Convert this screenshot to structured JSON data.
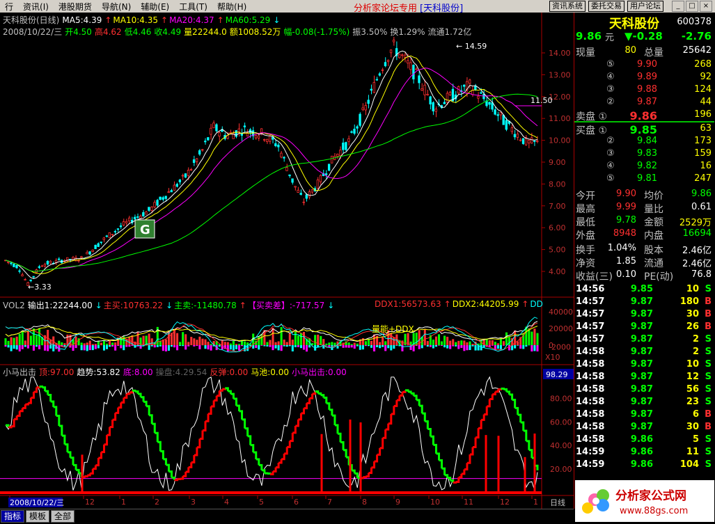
{
  "menu": [
    "行",
    "资讯(I)",
    "港股期货",
    "导航(N)",
    "辅助(E)",
    "工具(T)",
    "帮助(H)"
  ],
  "banner": {
    "text": "分析家论坛专用",
    "stock": "[天科股份]"
  },
  "top_buttons": [
    "资讯系统",
    "委托交易",
    "用户论坛"
  ],
  "window_controls": [
    "_",
    "□",
    "×"
  ],
  "price_panel": {
    "line1": [
      {
        "text": "天科股份(日线)",
        "color": "#c0c0c0"
      },
      {
        "text": "MA5:4.39",
        "color": "#ffffff"
      },
      {
        "text": "↑",
        "color": "#ff3030"
      },
      {
        "text": "MA10:4.35",
        "color": "#ffff00"
      },
      {
        "text": "↑",
        "color": "#ff3030"
      },
      {
        "text": "MA20:4.37",
        "color": "#ff00ff"
      },
      {
        "text": "↑",
        "color": "#ff3030"
      },
      {
        "text": "MA60:5.29",
        "color": "#00ff00"
      },
      {
        "text": "↓",
        "color": "#00ffff"
      }
    ],
    "line2": [
      {
        "text": "2008/10/22/三",
        "color": "#c0c0c0"
      },
      {
        "text": "开4.50",
        "color": "#00ff00"
      },
      {
        "text": "高4.62",
        "color": "#ff3030"
      },
      {
        "text": "低4.46",
        "color": "#00ff00"
      },
      {
        "text": "收4.49",
        "color": "#00ff00"
      },
      {
        "text": "量22244.0",
        "color": "#ffff00"
      },
      {
        "text": "额1008.52万",
        "color": "#ffff00"
      },
      {
        "text": "幅-0.08(-1.75%)",
        "color": "#00ff00"
      },
      {
        "text": "振3.50%",
        "color": "#c0c0c0"
      },
      {
        "text": "换1.29%",
        "color": "#c0c0c0"
      },
      {
        "text": "流通1.72亿",
        "color": "#c0c0c0"
      }
    ],
    "y_ticks": [
      "14.00",
      "13.00",
      "12.00",
      "11.00",
      "10.00",
      "9.00",
      "8.00",
      "7.00",
      "6.00",
      "5.00",
      "4.00"
    ],
    "high_label": "14.59",
    "low_label": "3.33",
    "current_marker": "11.50",
    "badge": "G"
  },
  "vol_panel": {
    "items": [
      {
        "text": "VOL2",
        "color": "#c0c0c0"
      },
      {
        "text": "输出1:22244.00",
        "color": "#ffffff"
      },
      {
        "text": "↓",
        "color": "#00ffff"
      },
      {
        "text": "主买:10763.22",
        "color": "#ff3030"
      },
      {
        "text": "↓",
        "color": "#00ffff"
      },
      {
        "text": "主卖:-11480.78",
        "color": "#00ff00"
      },
      {
        "text": "↑",
        "color": "#ff3030"
      },
      {
        "text": "【买卖差】:-717.57",
        "color": "#ff00ff"
      },
      {
        "text": "↓",
        "color": "#00ffff"
      }
    ],
    "right_items": [
      {
        "text": "DDX1:56573.63",
        "color": "#ff3030"
      },
      {
        "text": "↑",
        "color": "#ff3030"
      },
      {
        "text": "DDX2:44205.99",
        "color": "#ffff00"
      },
      {
        "text": "↑",
        "color": "#ff3030"
      },
      {
        "text": "DD",
        "color": "#00ffff"
      }
    ],
    "y_ticks": [
      "40000",
      "20000",
      "0",
      "-2000"
    ],
    "annotation": "量能+DDX",
    "x10_label": "X10"
  },
  "osc_panel": {
    "items": [
      {
        "text": "小马出击",
        "color": "#c0c0c0"
      },
      {
        "text": "顶:97.00",
        "color": "#ff3030"
      },
      {
        "text": "趋势:53.82",
        "color": "#ffffff"
      },
      {
        "text": "底:8.00",
        "color": "#ff00ff"
      },
      {
        "text": "操盘:4.29.54",
        "color": "#606060"
      },
      {
        "text": "反弹:0.00",
        "color": "#ff3030"
      },
      {
        "text": "马池:0.00",
        "color": "#ffff00"
      },
      {
        "text": "小马出击:0.00",
        "color": "#ff00ff"
      }
    ],
    "y_ticks": [
      "80.00",
      "60.00",
      "40.00",
      "20.00"
    ],
    "current_value": "98.29"
  },
  "x_axis": {
    "labels": [
      "11",
      "12",
      "1",
      "2",
      "3",
      "4",
      "5",
      "6",
      "7",
      "8",
      "9",
      "10",
      "11",
      "12",
      "1",
      "2"
    ],
    "date": "2008/10/22/三",
    "period": "日线"
  },
  "tabs": [
    "指标",
    "模板",
    "全部"
  ],
  "quote": {
    "name": "天科股份",
    "code": "600378",
    "price": "9.86",
    "unit": "元",
    "change_arrow": "▼",
    "change": "-0.28",
    "change_pct": "-2.76",
    "current_vol_label": "现量",
    "current_vol": "80",
    "total_vol_label": "总量",
    "total_vol": "25642",
    "sells": [
      {
        "lv": "⑤",
        "price": "9.90",
        "vol": "268"
      },
      {
        "lv": "④",
        "price": "9.89",
        "vol": "92"
      },
      {
        "lv": "③",
        "price": "9.88",
        "vol": "124"
      },
      {
        "lv": "②",
        "price": "9.87",
        "vol": "44"
      },
      {
        "lv": "卖盘 ①",
        "price": "9.86",
        "vol": "196"
      }
    ],
    "buys": [
      {
        "lv": "买盘 ①",
        "price": "9.85",
        "vol": "63"
      },
      {
        "lv": "②",
        "price": "9.84",
        "vol": "173"
      },
      {
        "lv": "③",
        "price": "9.83",
        "vol": "159"
      },
      {
        "lv": "④",
        "price": "9.82",
        "vol": "16"
      },
      {
        "lv": "⑤",
        "price": "9.81",
        "vol": "247"
      }
    ],
    "stats": [
      {
        "l": "今开",
        "v": "9.90",
        "vc": "#ff3030",
        "l2": "均价",
        "v2": "9.86",
        "v2c": "#00ff00"
      },
      {
        "l": "最高",
        "v": "9.99",
        "vc": "#ff3030",
        "l2": "量比",
        "v2": "0.61",
        "v2c": "#ffffff"
      },
      {
        "l": "最低",
        "v": "9.78",
        "vc": "#00ff00",
        "l2": "金额",
        "v2": "2529万",
        "v2c": "#ffff00"
      },
      {
        "l": "外盘",
        "v": "8948",
        "vc": "#ff3030",
        "l2": "内盘",
        "v2": "16694",
        "v2c": "#00ff00"
      }
    ],
    "stats2": [
      {
        "l": "换手",
        "v": "1.04%",
        "l2": "股本",
        "v2": "2.46亿"
      },
      {
        "l": "净资",
        "v": "1.85",
        "l2": "流通",
        "v2": "2.46亿"
      },
      {
        "l": "收益(三)",
        "v": "0.10",
        "l2": "PE(动)",
        "v2": "76.8"
      }
    ],
    "ticks": [
      {
        "t": "14:56",
        "p": "9.85",
        "v": "10",
        "bs": "S"
      },
      {
        "t": "14:57",
        "p": "9.87",
        "v": "180",
        "bs": "B"
      },
      {
        "t": "14:57",
        "p": "9.87",
        "v": "30",
        "bs": "B"
      },
      {
        "t": "14:57",
        "p": "9.87",
        "v": "26",
        "bs": "B"
      },
      {
        "t": "14:57",
        "p": "9.87",
        "v": "2",
        "bs": "S"
      },
      {
        "t": "14:58",
        "p": "9.87",
        "v": "2",
        "bs": "S"
      },
      {
        "t": "14:58",
        "p": "9.87",
        "v": "10",
        "bs": "S"
      },
      {
        "t": "14:58",
        "p": "9.87",
        "v": "12",
        "bs": "S"
      },
      {
        "t": "14:58",
        "p": "9.87",
        "v": "56",
        "bs": "S"
      },
      {
        "t": "14:58",
        "p": "9.87",
        "v": "23",
        "bs": "S"
      },
      {
        "t": "14:58",
        "p": "9.87",
        "v": "6",
        "bs": "B"
      },
      {
        "t": "14:58",
        "p": "9.87",
        "v": "30",
        "bs": "B"
      },
      {
        "t": "14:58",
        "p": "9.86",
        "v": "5",
        "bs": "S"
      },
      {
        "t": "14:59",
        "p": "9.86",
        "v": "11",
        "bs": "S"
      },
      {
        "t": "14:59",
        "p": "9.86",
        "v": "104",
        "bs": "S"
      }
    ]
  },
  "logo": {
    "text": "分析家公式网",
    "url": "www.88gs.com"
  }
}
